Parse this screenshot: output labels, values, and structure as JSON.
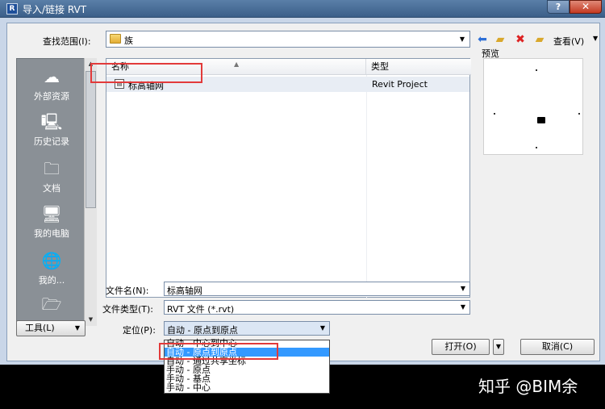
{
  "window": {
    "title": "导入/链接 RVT",
    "help_label": "?",
    "close_label": "✕"
  },
  "lookin": {
    "label": "查找范围(I):",
    "value": "族"
  },
  "toolbar": {
    "views_label": "查看(V)"
  },
  "places": [
    {
      "label": "外部资源",
      "icon": "cloud-icon"
    },
    {
      "label": "历史记录",
      "icon": "history-icon"
    },
    {
      "label": "文档",
      "icon": "documents-icon"
    },
    {
      "label": "我的电脑",
      "icon": "computer-icon"
    },
    {
      "label": "我的...",
      "icon": "network-icon"
    },
    {
      "label": "",
      "icon": "favorites-folder-icon"
    }
  ],
  "filelist": {
    "columns": [
      "名称",
      "类型"
    ],
    "rows": [
      {
        "name": "标高轴网",
        "type": "Revit Project"
      }
    ]
  },
  "preview": {
    "label": "预览"
  },
  "filename": {
    "label": "文件名(N):",
    "value": "标高轴网"
  },
  "filetype": {
    "label": "文件类型(T):",
    "value": "RVT 文件 (*.rvt)"
  },
  "positioning": {
    "label": "定位(P):",
    "value": "自动 - 原点到原点",
    "options": [
      "自动 - 中心到中心",
      "自动 - 原点到原点",
      "自动 - 通过共享坐标",
      "手动 - 原点",
      "手动 - 基点",
      "手动 - 中心"
    ],
    "selected_index": 1
  },
  "buttons": {
    "tools": "工具(L)",
    "open": "打开(O)",
    "cancel": "取消(C)"
  },
  "watermark": "知乎 @BIM余",
  "colors": {
    "highlight": "#e23a3a",
    "selection": "#3399ff",
    "places_bg": "#8a9096"
  }
}
